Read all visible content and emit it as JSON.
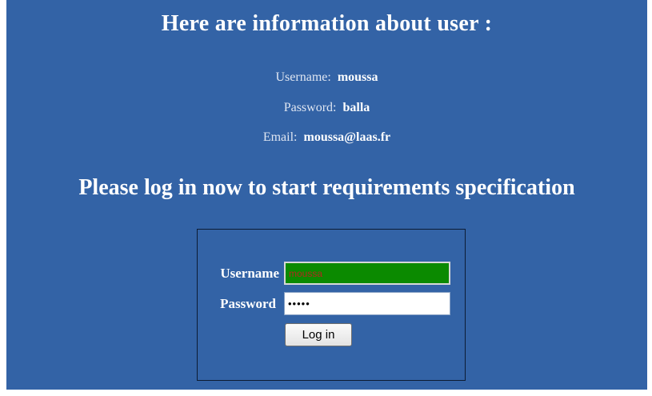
{
  "info": {
    "heading": "Here are information about user :",
    "username_label": "Username:",
    "username_value": "moussa",
    "password_label": "Password:",
    "password_value": "balla",
    "email_label": "Email:",
    "email_value": "moussa@laas.fr"
  },
  "login": {
    "heading": "Please log in now to start requirements specification",
    "username_label": "Username",
    "username_value": "moussa",
    "password_label": "Password",
    "password_value": "balla",
    "button_label": "Log in"
  },
  "colors": {
    "page_background": "#3363a6",
    "username_field_background": "#0b8a00",
    "username_field_text": "#b0291f"
  }
}
